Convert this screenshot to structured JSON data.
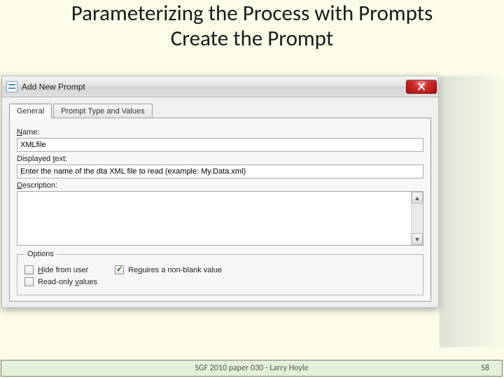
{
  "slide": {
    "title_line1": "Parameterizing the Process with Prompts",
    "title_line2": "Create the Prompt"
  },
  "dialog": {
    "title": "Add New Prompt",
    "close_icon_name": "close-icon",
    "tabs": [
      {
        "label": "General",
        "active": true
      },
      {
        "label": "Prompt Type and Values",
        "active": false
      }
    ],
    "fields": {
      "name": {
        "label_pre": "",
        "label_u": "N",
        "label_post": "ame:",
        "value": "XMLfile"
      },
      "displayed_text": {
        "label_pre": "Displayed ",
        "label_u": "t",
        "label_post": "ext:",
        "value": "Enter the name of the dta XML file to read (example: My.Data.xml)"
      },
      "description": {
        "label_pre": "",
        "label_u": "D",
        "label_post": "escription:",
        "value": ""
      }
    },
    "options": {
      "legend": "Options",
      "hide": {
        "label_pre": "",
        "label_u": "H",
        "label_post": "ide from user",
        "checked": false
      },
      "require": {
        "label_pre": "Re",
        "label_u": "q",
        "label_post": "uires a non-blank value",
        "checked": true
      },
      "readonly": {
        "label_pre": "Read-only ",
        "label_u": "v",
        "label_post": "alues",
        "checked": false
      }
    }
  },
  "footer": {
    "center": "SGF 2010 paper 030 - Larry Hoyle",
    "pageno": "58"
  }
}
